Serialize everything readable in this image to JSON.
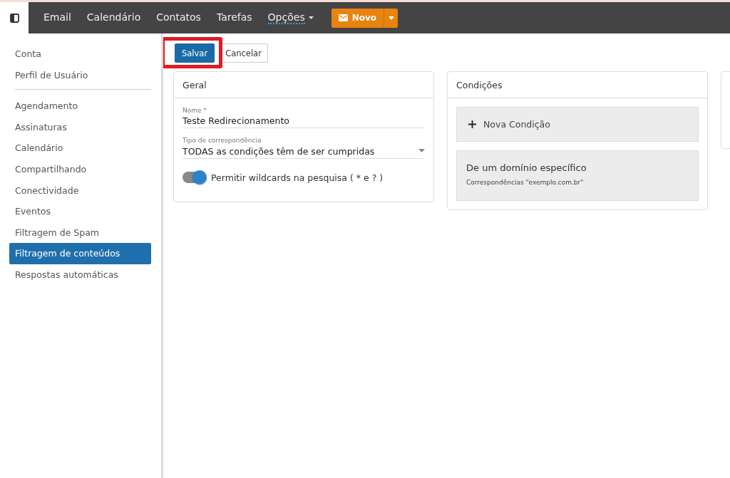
{
  "nav": [
    {
      "label": "Email",
      "selected": false,
      "dropdown": false
    },
    {
      "label": "Calendário",
      "selected": false,
      "dropdown": false
    },
    {
      "label": "Contatos",
      "selected": false,
      "dropdown": false
    },
    {
      "label": "Tarefas",
      "selected": false,
      "dropdown": false
    },
    {
      "label": "Opções",
      "selected": true,
      "dropdown": true
    }
  ],
  "new_button": {
    "label": "Novo"
  },
  "sidebar": {
    "groups": [
      [
        {
          "label": "Conta",
          "selected": false
        },
        {
          "label": "Perfil de Usuário",
          "selected": false
        }
      ],
      [
        {
          "label": "Agendamento",
          "selected": false
        },
        {
          "label": "Assinaturas",
          "selected": false
        },
        {
          "label": "Calendário",
          "selected": false
        },
        {
          "label": "Compartilhando",
          "selected": false
        },
        {
          "label": "Conectividade",
          "selected": false
        },
        {
          "label": "Eventos",
          "selected": false
        },
        {
          "label": "Filtragem de Spam",
          "selected": false
        },
        {
          "label": "Filtragem de conteúdos",
          "selected": true
        },
        {
          "label": "Respostas automáticas",
          "selected": false
        }
      ]
    ]
  },
  "toolbar": {
    "save": "Salvar",
    "cancel": "Cancelar",
    "save_highlighted": true
  },
  "general": {
    "title": "Geral",
    "name_label": "Nome *",
    "name_value": "Teste Redirecionamento",
    "match_label": "Tipo de correspondência",
    "match_value": "TODAS as condições têm de ser cumpridas",
    "wildcards": {
      "label": "Permitir wildcards na pesquisa ( * e ? )",
      "on": true
    }
  },
  "conditions": {
    "title": "Condições",
    "add": "Nova Condição",
    "items": [
      {
        "title": "De um domínio específico",
        "detail": "Correspondências \"exemplo.com.br\""
      }
    ]
  }
}
